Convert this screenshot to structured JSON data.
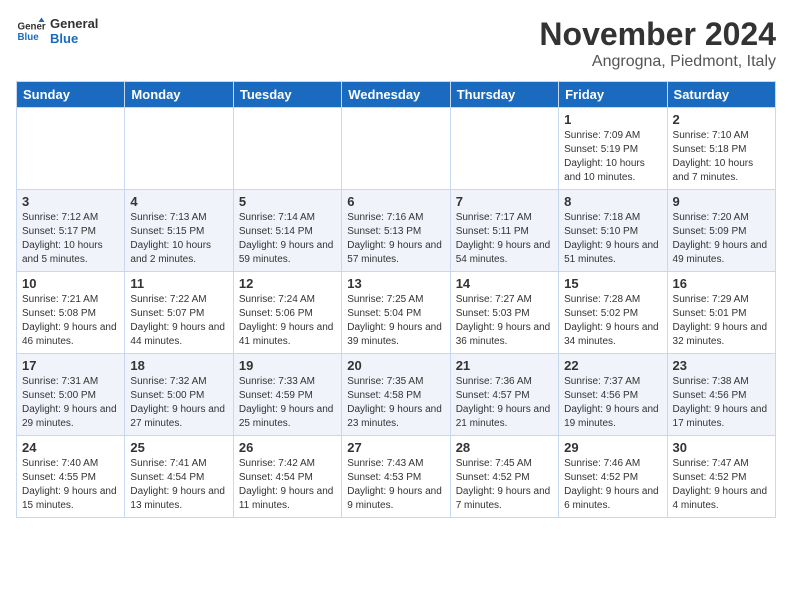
{
  "logo": {
    "line1": "General",
    "line2": "Blue"
  },
  "title": "November 2024",
  "subtitle": "Angrogna, Piedmont, Italy",
  "days_of_week": [
    "Sunday",
    "Monday",
    "Tuesday",
    "Wednesday",
    "Thursday",
    "Friday",
    "Saturday"
  ],
  "weeks": [
    [
      {
        "day": "",
        "info": ""
      },
      {
        "day": "",
        "info": ""
      },
      {
        "day": "",
        "info": ""
      },
      {
        "day": "",
        "info": ""
      },
      {
        "day": "",
        "info": ""
      },
      {
        "day": "1",
        "info": "Sunrise: 7:09 AM\nSunset: 5:19 PM\nDaylight: 10 hours and 10 minutes."
      },
      {
        "day": "2",
        "info": "Sunrise: 7:10 AM\nSunset: 5:18 PM\nDaylight: 10 hours and 7 minutes."
      }
    ],
    [
      {
        "day": "3",
        "info": "Sunrise: 7:12 AM\nSunset: 5:17 PM\nDaylight: 10 hours and 5 minutes."
      },
      {
        "day": "4",
        "info": "Sunrise: 7:13 AM\nSunset: 5:15 PM\nDaylight: 10 hours and 2 minutes."
      },
      {
        "day": "5",
        "info": "Sunrise: 7:14 AM\nSunset: 5:14 PM\nDaylight: 9 hours and 59 minutes."
      },
      {
        "day": "6",
        "info": "Sunrise: 7:16 AM\nSunset: 5:13 PM\nDaylight: 9 hours and 57 minutes."
      },
      {
        "day": "7",
        "info": "Sunrise: 7:17 AM\nSunset: 5:11 PM\nDaylight: 9 hours and 54 minutes."
      },
      {
        "day": "8",
        "info": "Sunrise: 7:18 AM\nSunset: 5:10 PM\nDaylight: 9 hours and 51 minutes."
      },
      {
        "day": "9",
        "info": "Sunrise: 7:20 AM\nSunset: 5:09 PM\nDaylight: 9 hours and 49 minutes."
      }
    ],
    [
      {
        "day": "10",
        "info": "Sunrise: 7:21 AM\nSunset: 5:08 PM\nDaylight: 9 hours and 46 minutes."
      },
      {
        "day": "11",
        "info": "Sunrise: 7:22 AM\nSunset: 5:07 PM\nDaylight: 9 hours and 44 minutes."
      },
      {
        "day": "12",
        "info": "Sunrise: 7:24 AM\nSunset: 5:06 PM\nDaylight: 9 hours and 41 minutes."
      },
      {
        "day": "13",
        "info": "Sunrise: 7:25 AM\nSunset: 5:04 PM\nDaylight: 9 hours and 39 minutes."
      },
      {
        "day": "14",
        "info": "Sunrise: 7:27 AM\nSunset: 5:03 PM\nDaylight: 9 hours and 36 minutes."
      },
      {
        "day": "15",
        "info": "Sunrise: 7:28 AM\nSunset: 5:02 PM\nDaylight: 9 hours and 34 minutes."
      },
      {
        "day": "16",
        "info": "Sunrise: 7:29 AM\nSunset: 5:01 PM\nDaylight: 9 hours and 32 minutes."
      }
    ],
    [
      {
        "day": "17",
        "info": "Sunrise: 7:31 AM\nSunset: 5:00 PM\nDaylight: 9 hours and 29 minutes."
      },
      {
        "day": "18",
        "info": "Sunrise: 7:32 AM\nSunset: 5:00 PM\nDaylight: 9 hours and 27 minutes."
      },
      {
        "day": "19",
        "info": "Sunrise: 7:33 AM\nSunset: 4:59 PM\nDaylight: 9 hours and 25 minutes."
      },
      {
        "day": "20",
        "info": "Sunrise: 7:35 AM\nSunset: 4:58 PM\nDaylight: 9 hours and 23 minutes."
      },
      {
        "day": "21",
        "info": "Sunrise: 7:36 AM\nSunset: 4:57 PM\nDaylight: 9 hours and 21 minutes."
      },
      {
        "day": "22",
        "info": "Sunrise: 7:37 AM\nSunset: 4:56 PM\nDaylight: 9 hours and 19 minutes."
      },
      {
        "day": "23",
        "info": "Sunrise: 7:38 AM\nSunset: 4:56 PM\nDaylight: 9 hours and 17 minutes."
      }
    ],
    [
      {
        "day": "24",
        "info": "Sunrise: 7:40 AM\nSunset: 4:55 PM\nDaylight: 9 hours and 15 minutes."
      },
      {
        "day": "25",
        "info": "Sunrise: 7:41 AM\nSunset: 4:54 PM\nDaylight: 9 hours and 13 minutes."
      },
      {
        "day": "26",
        "info": "Sunrise: 7:42 AM\nSunset: 4:54 PM\nDaylight: 9 hours and 11 minutes."
      },
      {
        "day": "27",
        "info": "Sunrise: 7:43 AM\nSunset: 4:53 PM\nDaylight: 9 hours and 9 minutes."
      },
      {
        "day": "28",
        "info": "Sunrise: 7:45 AM\nSunset: 4:52 PM\nDaylight: 9 hours and 7 minutes."
      },
      {
        "day": "29",
        "info": "Sunrise: 7:46 AM\nSunset: 4:52 PM\nDaylight: 9 hours and 6 minutes."
      },
      {
        "day": "30",
        "info": "Sunrise: 7:47 AM\nSunset: 4:52 PM\nDaylight: 9 hours and 4 minutes."
      }
    ]
  ]
}
